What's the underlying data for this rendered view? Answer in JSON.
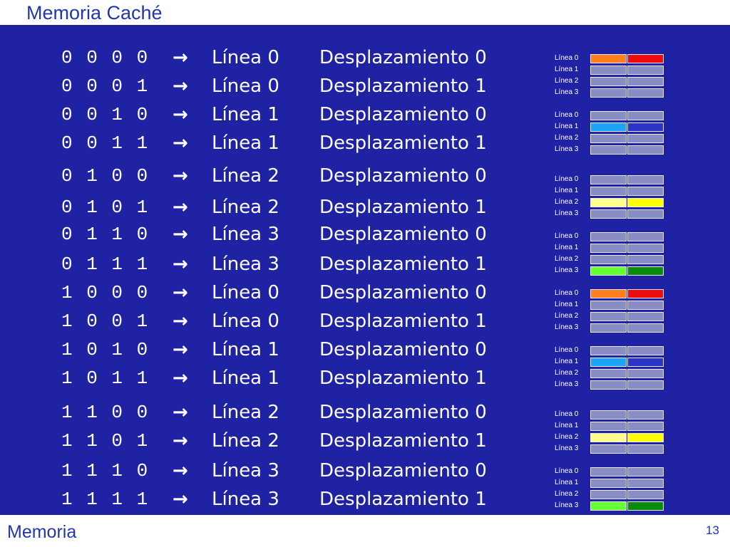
{
  "slide_title": "Memoria Caché",
  "footer_label": "Memoria",
  "page_number": "13",
  "arrow_glyph": "→",
  "rows": [
    {
      "bits": "0 0 0 0",
      "line": "Línea 0",
      "disp": "Desplazamiento 0"
    },
    {
      "bits": "0 0 0 1",
      "line": "Línea 0",
      "disp": "Desplazamiento 1"
    },
    {
      "bits": "0 0 1 0",
      "line": "Línea 1",
      "disp": "Desplazamiento 0"
    },
    {
      "bits": "0 0 1 1",
      "line": "Línea 1",
      "disp": "Desplazamiento 1"
    },
    {
      "bits": "0 1 0 0",
      "line": "Línea 2",
      "disp": "Desplazamiento 0"
    },
    {
      "bits": "0 1 0 1",
      "line": "Línea 2",
      "disp": "Desplazamiento 1"
    },
    {
      "bits": "0 1 1 0",
      "line": "Línea 3",
      "disp": "Desplazamiento 0"
    },
    {
      "bits": "0 1 1 1",
      "line": "Línea 3",
      "disp": "Desplazamiento 1"
    },
    {
      "bits": "1 0 0 0",
      "line": "Línea 0",
      "disp": "Desplazamiento 0"
    },
    {
      "bits": "1 0 0 1",
      "line": "Línea 0",
      "disp": "Desplazamiento 1"
    },
    {
      "bits": "1 0 1 0",
      "line": "Línea 1",
      "disp": "Desplazamiento 0"
    },
    {
      "bits": "1 0 1 1",
      "line": "Línea 1",
      "disp": "Desplazamiento 1"
    },
    {
      "bits": "1 1 0 0",
      "line": "Línea 2",
      "disp": "Desplazamiento 0"
    },
    {
      "bits": "1 1 0 1",
      "line": "Línea 2",
      "disp": "Desplazamiento 1"
    },
    {
      "bits": "1 1 1 0",
      "line": "Línea 3",
      "disp": "Desplazamiento 0"
    },
    {
      "bits": "1 1 1 1",
      "line": "Línea 3",
      "disp": "Desplazamiento 1"
    }
  ],
  "cache_line_labels": [
    "Línea 0",
    "Línea 1",
    "Línea 2",
    "Línea 3"
  ],
  "cell_empty_color": "#8a8cc4",
  "cache_diagrams": [
    {
      "highlight_line": 0,
      "colors": [
        "#ff7f1e",
        "#ee0b0b"
      ]
    },
    {
      "highlight_line": 1,
      "colors": [
        "#1ea4f5",
        "#2a35c6"
      ]
    },
    {
      "highlight_line": 2,
      "colors": [
        "#ffff8a",
        "#ffff00"
      ]
    },
    {
      "highlight_line": 3,
      "colors": [
        "#66ff33",
        "#0a8c0a"
      ]
    },
    {
      "highlight_line": 0,
      "colors": [
        "#ff7f1e",
        "#ee0b0b"
      ]
    },
    {
      "highlight_line": 1,
      "colors": [
        "#1ea4f5",
        "#2a35c6"
      ]
    },
    {
      "highlight_line": 2,
      "colors": [
        "#ffff8a",
        "#ffff00"
      ]
    },
    {
      "highlight_line": 3,
      "colors": [
        "#66ff33",
        "#0a8c0a"
      ]
    }
  ]
}
